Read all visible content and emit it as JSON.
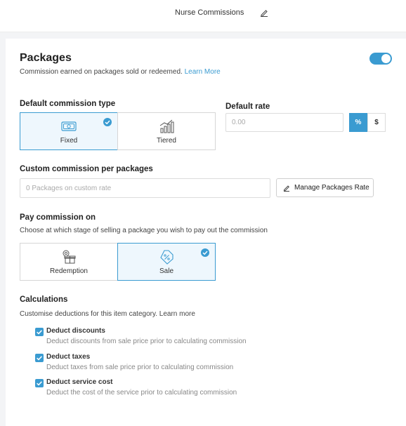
{
  "topbar": {
    "title": "Nurse Commissions",
    "edit_icon": "pencil-icon"
  },
  "packages": {
    "title": "Packages",
    "description": "Commission earned on packages sold or redeemed.",
    "learn_more": "Learn More",
    "enabled": true
  },
  "default_commission_type": {
    "title": "Default commission type",
    "options": [
      {
        "label": "Fixed",
        "icon": "money-icon",
        "selected": true
      },
      {
        "label": "Tiered",
        "icon": "tiered-chart-icon",
        "selected": false
      }
    ]
  },
  "default_rate": {
    "title": "Default rate",
    "placeholder": "0.00",
    "units": [
      {
        "label": "%",
        "selected": true
      },
      {
        "label": "$",
        "selected": false
      }
    ]
  },
  "custom_commission": {
    "title": "Custom commission per packages",
    "placeholder": "0 Packages on custom rate",
    "manage_button": "Manage Packages Rate"
  },
  "pay_commission": {
    "title": "Pay commission on",
    "description": "Choose at which stage of selling a package you wish to pay out the commission",
    "options": [
      {
        "label": "Redemption",
        "icon": "gift-icon",
        "selected": false
      },
      {
        "label": "Sale",
        "icon": "price-tag-icon",
        "selected": true
      }
    ]
  },
  "calculations": {
    "title": "Calculations",
    "description": "Customise deductions for this item category. Learn more",
    "items": [
      {
        "label": "Deduct discounts",
        "description": "Deduct discounts from sale price prior to calculating commission",
        "checked": true
      },
      {
        "label": "Deduct taxes",
        "description": "Deduct taxes from sale price prior to calculating commission",
        "checked": true
      },
      {
        "label": "Deduct service cost",
        "description": "Deduct the cost of the service prior to calculating commission",
        "checked": true
      }
    ]
  },
  "colors": {
    "accent": "#3a9bd1",
    "selected_bg": "#eef7fd"
  }
}
